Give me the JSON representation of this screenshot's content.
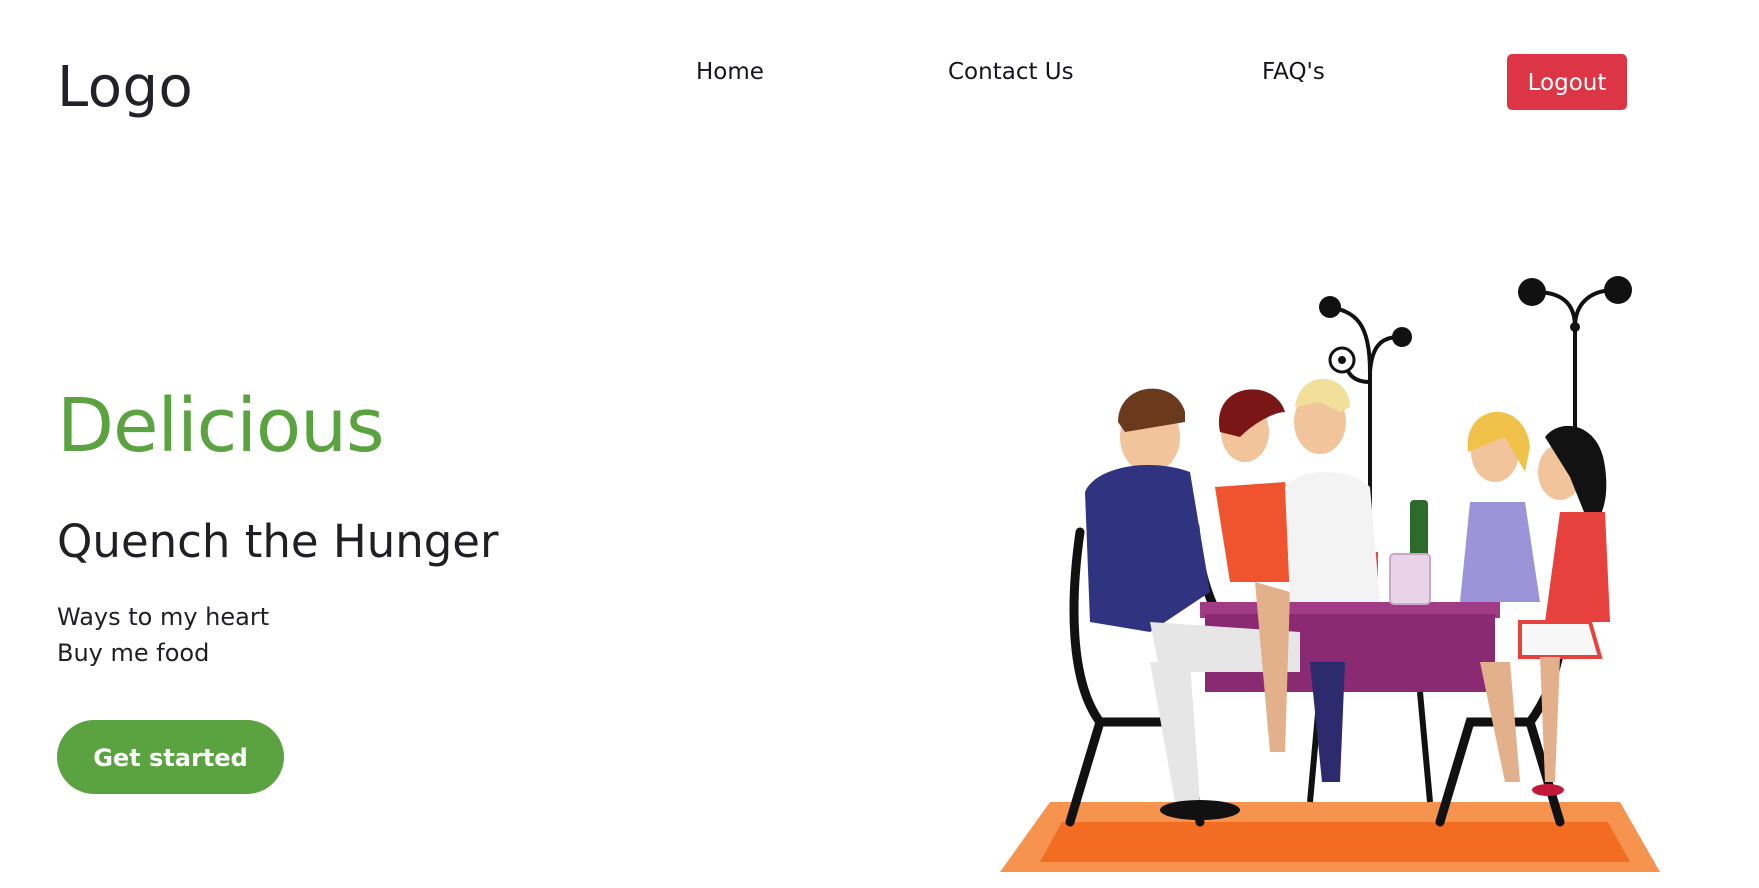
{
  "header": {
    "logo_text": "Logo",
    "nav": [
      {
        "label": "Home"
      },
      {
        "label": "Contact Us"
      },
      {
        "label": "FAQ's"
      }
    ],
    "logout_label": "Logout"
  },
  "hero": {
    "title": "Delicious",
    "subtitle": "Quench the Hunger",
    "lines": [
      "Ways to my heart",
      "Buy me food"
    ],
    "cta_label": "Get started"
  },
  "colors": {
    "accent_green": "#5ba240",
    "logout_red": "#dc3545",
    "text_dark": "#1f1f24"
  },
  "illustration": {
    "icon": "dinner-party-illustration"
  }
}
